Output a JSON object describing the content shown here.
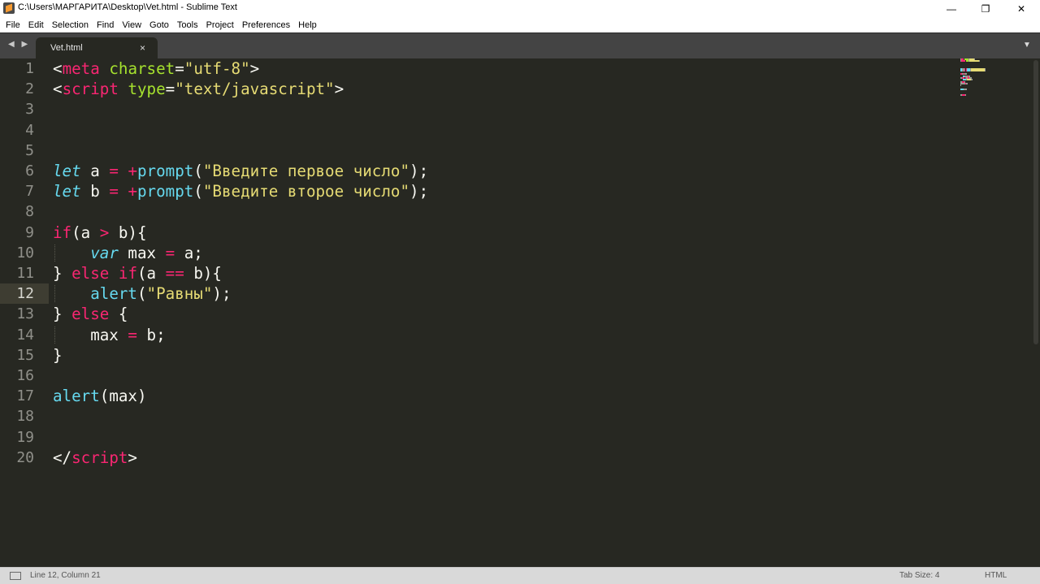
{
  "window": {
    "title": "C:\\Users\\МАРГАРИТА\\Desktop\\Vet.html - Sublime Text",
    "minimize": "—",
    "maximize": "❐",
    "close": "✕"
  },
  "menu": [
    "File",
    "Edit",
    "Selection",
    "Find",
    "View",
    "Goto",
    "Tools",
    "Project",
    "Preferences",
    "Help"
  ],
  "tabs": {
    "nav_arrows": "◀ ▶",
    "active_tab": "Vet.html",
    "close_glyph": "×",
    "dropdown_glyph": "▼"
  },
  "editor": {
    "current_line": 12,
    "lines": [
      {
        "n": "1",
        "tokens": [
          {
            "t": "<",
            "c": "plain"
          },
          {
            "t": "meta",
            "c": "kw"
          },
          {
            "t": " ",
            "c": "plain"
          },
          {
            "t": "charset",
            "c": "attr"
          },
          {
            "t": "=",
            "c": "plain"
          },
          {
            "t": "\"utf-8\"",
            "c": "str"
          },
          {
            "t": ">",
            "c": "plain"
          }
        ]
      },
      {
        "n": "2",
        "tokens": [
          {
            "t": "<",
            "c": "plain"
          },
          {
            "t": "script",
            "c": "kw"
          },
          {
            "t": " ",
            "c": "plain"
          },
          {
            "t": "type",
            "c": "attr"
          },
          {
            "t": "=",
            "c": "plain"
          },
          {
            "t": "\"text/javascript\"",
            "c": "str"
          },
          {
            "t": ">",
            "c": "plain"
          }
        ]
      },
      {
        "n": "3",
        "tokens": []
      },
      {
        "n": "4",
        "tokens": []
      },
      {
        "n": "5",
        "tokens": []
      },
      {
        "n": "6",
        "tokens": [
          {
            "t": "let",
            "c": "storage"
          },
          {
            "t": " a ",
            "c": "plain"
          },
          {
            "t": "=",
            "c": "kw"
          },
          {
            "t": " ",
            "c": "plain"
          },
          {
            "t": "+",
            "c": "kw"
          },
          {
            "t": "prompt",
            "c": "fn"
          },
          {
            "t": "(",
            "c": "plain"
          },
          {
            "t": "\"Введите первое число\"",
            "c": "str"
          },
          {
            "t": ");",
            "c": "plain"
          }
        ]
      },
      {
        "n": "7",
        "tokens": [
          {
            "t": "let",
            "c": "storage"
          },
          {
            "t": " b ",
            "c": "plain"
          },
          {
            "t": "=",
            "c": "kw"
          },
          {
            "t": " ",
            "c": "plain"
          },
          {
            "t": "+",
            "c": "kw"
          },
          {
            "t": "prompt",
            "c": "fn"
          },
          {
            "t": "(",
            "c": "plain"
          },
          {
            "t": "\"Введите второе число\"",
            "c": "str"
          },
          {
            "t": ");",
            "c": "plain"
          }
        ]
      },
      {
        "n": "8",
        "tokens": []
      },
      {
        "n": "9",
        "tokens": [
          {
            "t": "if",
            "c": "kw"
          },
          {
            "t": "(a ",
            "c": "plain"
          },
          {
            "t": ">",
            "c": "kw"
          },
          {
            "t": " b){",
            "c": "plain"
          }
        ]
      },
      {
        "n": "10",
        "tokens": [
          {
            "t": "    ",
            "c": "plain"
          },
          {
            "t": "var",
            "c": "storage"
          },
          {
            "t": " max ",
            "c": "plain"
          },
          {
            "t": "=",
            "c": "kw"
          },
          {
            "t": " a;",
            "c": "plain"
          }
        ]
      },
      {
        "n": "11",
        "tokens": [
          {
            "t": "} ",
            "c": "plain"
          },
          {
            "t": "else",
            "c": "kw"
          },
          {
            "t": " ",
            "c": "plain"
          },
          {
            "t": "if",
            "c": "kw"
          },
          {
            "t": "(a ",
            "c": "plain"
          },
          {
            "t": "==",
            "c": "kw"
          },
          {
            "t": " b){",
            "c": "plain"
          }
        ]
      },
      {
        "n": "12",
        "tokens": [
          {
            "t": "    ",
            "c": "plain"
          },
          {
            "t": "alert",
            "c": "fn"
          },
          {
            "t": "(",
            "c": "plain"
          },
          {
            "t": "\"Равны\"",
            "c": "str"
          },
          {
            "t": ");",
            "c": "plain"
          }
        ]
      },
      {
        "n": "13",
        "tokens": [
          {
            "t": "} ",
            "c": "plain"
          },
          {
            "t": "else",
            "c": "kw"
          },
          {
            "t": " {",
            "c": "plain"
          }
        ]
      },
      {
        "n": "14",
        "tokens": [
          {
            "t": "    max ",
            "c": "plain"
          },
          {
            "t": "=",
            "c": "kw"
          },
          {
            "t": " b;",
            "c": "plain"
          }
        ]
      },
      {
        "n": "15",
        "tokens": [
          {
            "t": "}",
            "c": "plain"
          }
        ]
      },
      {
        "n": "16",
        "tokens": []
      },
      {
        "n": "17",
        "tokens": [
          {
            "t": "alert",
            "c": "fn"
          },
          {
            "t": "(max)",
            "c": "plain"
          }
        ]
      },
      {
        "n": "18",
        "tokens": []
      },
      {
        "n": "19",
        "tokens": []
      },
      {
        "n": "20",
        "tokens": [
          {
            "t": "</",
            "c": "plain"
          },
          {
            "t": "script",
            "c": "kw"
          },
          {
            "t": ">",
            "c": "plain"
          }
        ]
      }
    ]
  },
  "status": {
    "position": "Line 12, Column 21",
    "tab_size": "Tab Size: 4",
    "syntax": "HTML"
  },
  "colors": {
    "background": "#272822",
    "keyword": "#f92672",
    "attribute": "#a6e22e",
    "string": "#e6db74",
    "function": "#66d9ef",
    "plain": "#f8f8f2"
  }
}
